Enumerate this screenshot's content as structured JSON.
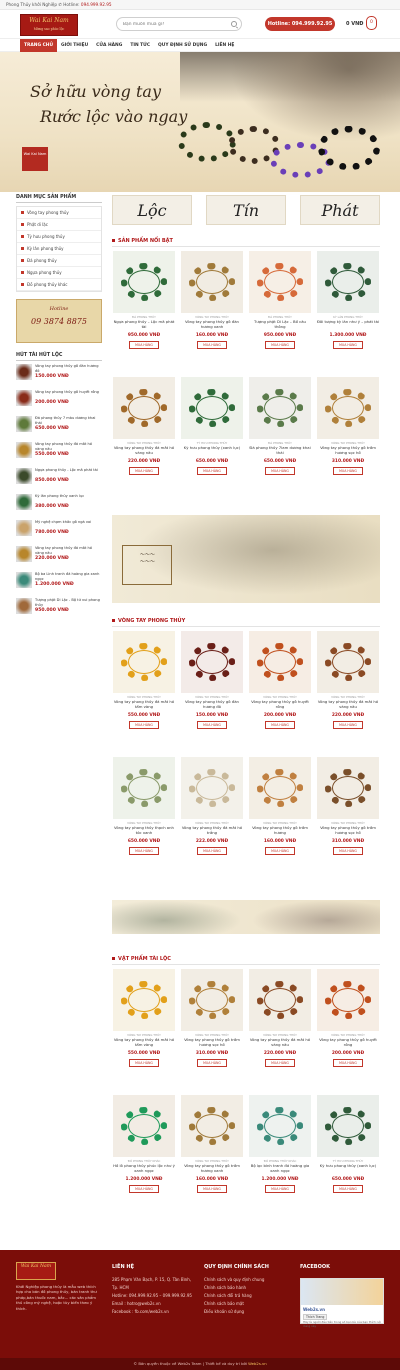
{
  "topbar": {
    "text": "Phong Thủy khởi Nghiệp",
    "hotline_label": "Hotline:",
    "hotline": "094.999.92.95"
  },
  "header": {
    "logo_text": "Wai Kai Nam",
    "logo_sub": "Mừng sao phúc lộc",
    "search_placeholder": "Bạn muốn mua gì?",
    "hotline_btn": "Hotline: 094.999.92.95",
    "cart_total": "0 VNĐ",
    "cart_count": "0"
  },
  "nav": [
    "TRANG CHỦ",
    "GIỚI THIỆU",
    "CỬA HÀNG",
    "TIN TỨC",
    "QUY ĐỊNH SỬ DỤNG",
    "LIÊN HỆ"
  ],
  "banner": {
    "line1": "Sở hữu vòng tay",
    "line2": "Rước lộc vào ngay",
    "seal": "Wai Kai Nam"
  },
  "sidebar": {
    "cat_title": "DANH MỤC SẢN PHẨM",
    "categories": [
      "Vòng tay phong thủy",
      "Phật di lặc",
      "Tỳ hưu phong thủy",
      "Kỳ lân phong thủy",
      "Đá phong thủy",
      "Ngựa phong thủy",
      "Đồ phong thủy khác"
    ],
    "ad_text": "Hotline",
    "ad_number": "09 3874 8875",
    "hot_title": "HÚT TÀI HÚT LỘC",
    "hot_items": [
      {
        "name": "Vòng tay phong thủy gỗ đàn hương đỏ",
        "price": "150.000 VNĐ"
      },
      {
        "name": "Vòng tay phong thủy gỗ huyết rồng",
        "price": "200.000 VNĐ"
      },
      {
        "name": "Đá phong thủy 7 màu dương khai thái",
        "price": "650.000 VNĐ"
      },
      {
        "name": "Vòng tay phong thủy đá mắt hổ vàng nâu",
        "price": "550.000 VNĐ"
      },
      {
        "name": "Ngựa phong thủy - Lộc mã phát tài",
        "price": "850.000 VNĐ"
      },
      {
        "name": "Kỳ lân phong thủy xanh lục",
        "price": "380.000 VNĐ"
      },
      {
        "name": "Mỹ nghệ chạm khắc gỗ ngà voi",
        "price": "780.000 VNĐ"
      },
      {
        "name": "Vòng tay phong thủy đá mắt hổ vàng nâu",
        "price": "220.000 VNĐ"
      },
      {
        "name": "Bộ ba Linh tranh đá hoàng gia xanh ngọc",
        "price": "1.200.000 VNĐ"
      },
      {
        "name": "Tượng phật Di Lặc - Bộ tứ vui phong thủy",
        "price": "950.000 VNĐ"
      }
    ]
  },
  "loc_tin_phat": [
    "Lộc",
    "Tín",
    "Phát"
  ],
  "sections": {
    "featured": "SẢN PHẨM NỔI BẬT",
    "bracelets": "VÒNG TAY PHONG THỦY",
    "luck": "VẬT PHẨM TÀI LỘC"
  },
  "category_label": "VÒNG TAY PHONG THỦY",
  "category_label2": "ĐÁ PHONG THỦY",
  "buy_label": "MUA HÀNG",
  "featured_products": [
    {
      "cat": "ĐÁ PHONG THỦY",
      "name": "Ngựa phong thủy – Lộc mã phát tài",
      "price": "950.000 VNĐ"
    },
    {
      "cat": "VÒNG TAY PHONG THỦY",
      "name": "Vòng tay phong thủy gỗ đàn hương xanh",
      "price": "160.000 VNĐ"
    },
    {
      "cat": "ĐÁ PHONG THỦY",
      "name": "Tượng phật Di Lặc – Bồ câu thông",
      "price": "950.000 VNĐ"
    },
    {
      "cat": "KỲ LÂN PHONG THỦY",
      "name": "Đôi tượng kỳ lân như ý – phát tài",
      "price": "1.300.000 VNĐ"
    },
    {
      "cat": "VÒNG TAY PHONG THỦY",
      "name": "Vòng tay phong thủy đá mắt hổ vàng nâu",
      "price": "220.000 VNĐ"
    },
    {
      "cat": "TỲ HƯU PHONG THỦY",
      "name": "Kỳ hưu phong thủy (xanh lục)",
      "price": "650.000 VNĐ"
    },
    {
      "cat": "ĐÁ PHONG THỦY",
      "name": "Đá phong thủy 7lam dương khai thái",
      "price": "650.000 VNĐ"
    },
    {
      "cat": "VÒNG TAY PHONG THỦY",
      "name": "Vòng tay phong thủy gỗ trầm hương sọc hồ",
      "price": "310.000 VNĐ"
    }
  ],
  "bracelet_products": [
    {
      "name": "Vòng tay phong thủy đá mắt hổ tấm vàng",
      "price": "550.000 VNĐ"
    },
    {
      "name": "Vòng tay phong thủy gỗ đàn hương đỏ",
      "price": "150.000 VNĐ"
    },
    {
      "name": "Vòng tay phong thủy gỗ huyết rồng",
      "price": "200.000 VNĐ"
    },
    {
      "name": "Vòng tay phong thủy đá mắt hổ vàng nâu",
      "price": "220.000 VNĐ"
    },
    {
      "name": "Vòng tay phong thủy thạch anh tóc xanh",
      "price": "650.000 VNĐ"
    },
    {
      "name": "Vòng tay phong thủy đá mắt hổ trắng",
      "price": "222.000 VNĐ"
    },
    {
      "name": "Vòng tay phong thủy gỗ trầm hương",
      "price": "160.000 VNĐ"
    },
    {
      "name": "Vòng tay phong thủy gỗ trầm hương sọc hồ",
      "price": "310.000 VNĐ"
    }
  ],
  "luck_products": [
    {
      "cat": "VÒNG TAY PHONG THỦY",
      "name": "Vòng tay phong thủy đá mắt hổ tấm vàng",
      "price": "550.000 VNĐ"
    },
    {
      "cat": "VÒNG TAY PHONG THỦY",
      "name": "Vòng tay phong thủy gỗ trầm hương sọc hồ",
      "price": "310.000 VNĐ"
    },
    {
      "cat": "VÒNG TAY PHONG THỦY",
      "name": "Vòng tay phong thủy đá mắt hổ vàng nâu",
      "price": "220.000 VNĐ"
    },
    {
      "cat": "VÒNG TAY PHONG THỦY",
      "name": "Vòng tay phong thủy gỗ huyết rồng",
      "price": "200.000 VNĐ"
    },
    {
      "cat": "ĐỒ PHONG THỦY KHÁC",
      "name": "Hồ lô phong thủy phúc lộc như ý xanh ngọc",
      "price": "1.200.000 VNĐ"
    },
    {
      "cat": "VÒNG TAY PHONG THỦY",
      "name": "Vòng tay phong thủy gỗ trầm hương xanh",
      "price": "160.000 VNĐ"
    },
    {
      "cat": "ĐỒ PHONG THỦY KHÁC",
      "name": "Bộ lọc bình tranh đá hoàng gia xanh ngọc",
      "price": "1.200.000 VNĐ"
    },
    {
      "cat": "TỲ HƯU PHONG THỦY",
      "name": "Kỳ hưu phong thủy (xanh lục)",
      "price": "650.000 VNĐ"
    }
  ],
  "footer": {
    "logo": "Wai Kai Nam",
    "desc": "Khởi Nghiệp phong thủy là mẫu web thích hợp cho bán đồ phong thủy, bán tranh thư pháp,bán thuốc nam, bắc... các sản phẩm thủ công mỹ nghệ, hoặc tùy biến theo ý thích.",
    "contact_title": "LIÊN HỆ",
    "contact": [
      "285 Phạm Văn Bạch, P. 15, Q. Tân Bình, Tp. HCM",
      "Hotline: 094.999.92.95 – 099.999.92.95",
      "Email : hotro@web2s.vn",
      "Facebook : fb.com/web2s.vn"
    ],
    "policy_title": "QUY ĐỊNH CHÍNH SÁCH",
    "policy": [
      "Chính sách và quy định chung",
      "Chính sách bảo hành",
      "Chính sách đổi trả hàng",
      "Chính sách bảo mật",
      "Điều khoản sử dụng"
    ],
    "fb_title": "FACEBOOK",
    "fb_name": "Web2s.vn",
    "fb_btn": "Thích Trang",
    "fb_note": "Hãy là người đầu tiên trong số bạn bè của bạn thích nội dung này"
  },
  "copyright": {
    "text": "© Bản quyền thuộc về Web2s Team | Thiết kế và duy trì bởi",
    "brand": "Web2s.vn"
  }
}
